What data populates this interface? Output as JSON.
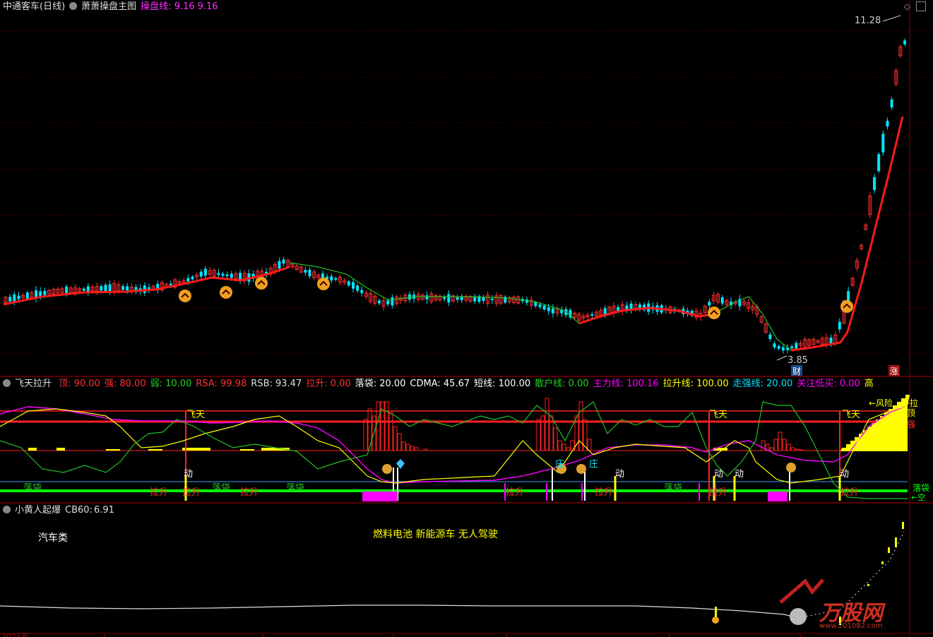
{
  "colors": {
    "up": "#ff3030",
    "down": "#00e5ff",
    "ma_red": "#ff1a1a",
    "ma_green": "#22c022",
    "yellow": "#ffff00",
    "magenta": "#ff00ff",
    "cyan": "#00ffff",
    "green_bright": "#00ff00",
    "axis": "#7a0000"
  },
  "main": {
    "stock": "中通客车(日线)",
    "indicator": "萧萧操盘主图",
    "line_label": "操盘线",
    "line_value": ": 9.16",
    "line_value2": "9.16",
    "high_label": "11.28",
    "low_label": "3.85",
    "badge_cai": "财",
    "badge_zhang": "涨"
  },
  "sub1": {
    "title": "飞天拉升",
    "items": [
      {
        "label": "顶:",
        "value": "90.00",
        "color": "#ff3030"
      },
      {
        "label": "强:",
        "value": "80.00",
        "color": "#ff3030"
      },
      {
        "label": "弱:",
        "value": "10.00",
        "color": "#22d022"
      },
      {
        "label": "RSA:",
        "value": "99.98",
        "color": "#ff3030"
      },
      {
        "label": "RSB:",
        "value": "93.47",
        "color": "#dddddd"
      },
      {
        "label": "拉升:",
        "value": "0.00",
        "color": "#ff3030"
      },
      {
        "label": "落袋:",
        "value": "20.00",
        "color": "#ffffff"
      },
      {
        "label": "CDMA:",
        "value": "45.67",
        "color": "#ffffff"
      },
      {
        "label": "短线:",
        "value": "100.00",
        "color": "#ffffff"
      },
      {
        "label": "散户线:",
        "value": "0.00",
        "color": "#22d022"
      },
      {
        "label": "主力线:",
        "value": "100.16",
        "color": "#ff00ff"
      },
      {
        "label": "拉升线:",
        "value": "100.00",
        "color": "#ffff00"
      },
      {
        "label": "走强线:",
        "value": "20.00",
        "color": "#00e5ff"
      },
      {
        "label": "关注低买:",
        "value": "0.00",
        "color": "#ff00ff"
      },
      {
        "label": "高",
        "value": "",
        "color": "#ffff00"
      }
    ],
    "feitian": "飞天",
    "dong": "动",
    "lasheng": "拉升",
    "luodai": "落袋",
    "zhuang": "庄",
    "fengxian": "←风险",
    "la": "←拉",
    "ding": "顶",
    "qiang": "强",
    "ruo": "弱",
    "kong": "←空"
  },
  "sub2": {
    "title": "小黄人起爆",
    "cb_label": "CB60:",
    "cb_value": "6.91",
    "category": "汽车类",
    "concepts": "燃料电池 新能源车 无人驾驶"
  },
  "watermark": {
    "brand": "万股网",
    "url": "www.201082.com"
  },
  "axis": {
    "year": "2021年"
  }
}
